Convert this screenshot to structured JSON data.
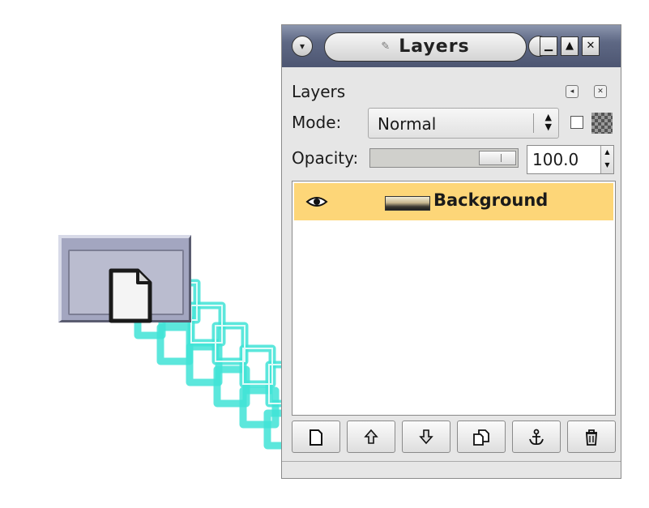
{
  "window": {
    "title": "Layers",
    "title_icon": "brush-icon",
    "titlebar_buttons": [
      "minimize-icon",
      "maximize-icon",
      "close-icon"
    ]
  },
  "panel": {
    "title": "Layers"
  },
  "mode": {
    "label": "Mode:",
    "value": "Normal"
  },
  "opacity": {
    "label": "Opacity:",
    "value": "100.0",
    "fraction": 1.0
  },
  "layers": [
    {
      "name": "Background",
      "visible": true,
      "selected": true
    }
  ],
  "bottom_buttons": [
    {
      "name": "new-layer-button",
      "icon": "new-document-icon"
    },
    {
      "name": "raise-layer-button",
      "icon": "arrow-up-icon"
    },
    {
      "name": "lower-layer-button",
      "icon": "arrow-down-icon"
    },
    {
      "name": "duplicate-layer-button",
      "icon": "duplicate-icon"
    },
    {
      "name": "anchor-layer-button",
      "icon": "anchor-icon"
    },
    {
      "name": "delete-layer-button",
      "icon": "trash-icon"
    }
  ],
  "colors": {
    "selected_row": "#fdd678",
    "highlight_trail": "#3fe3d6",
    "titlebar": "#5e6884"
  }
}
